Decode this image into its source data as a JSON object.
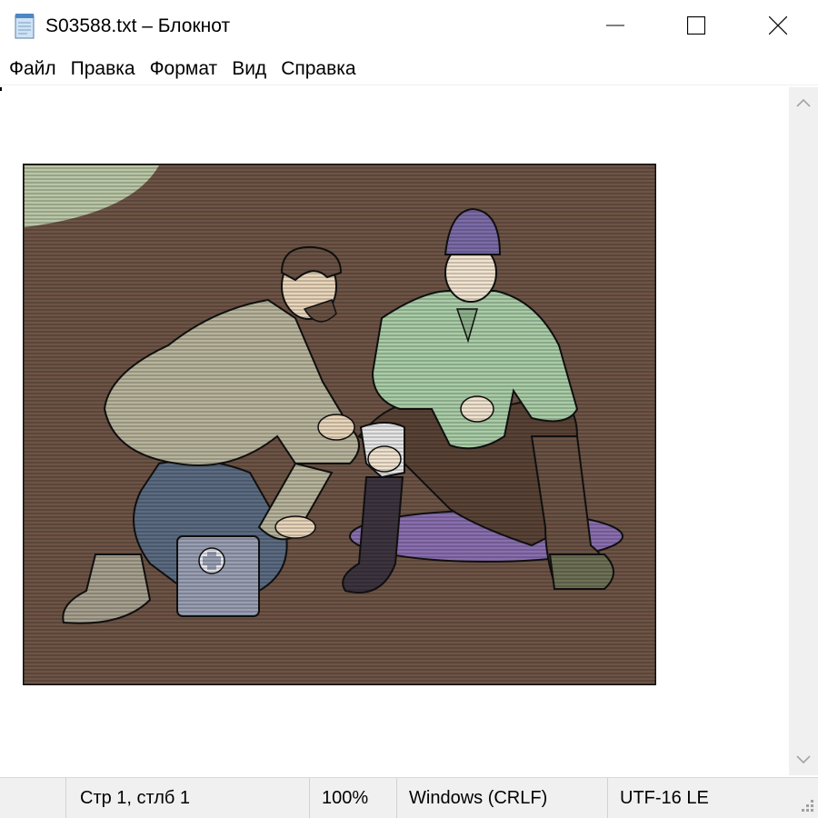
{
  "window": {
    "title": "S03588.txt – Блокнот",
    "app_icon": "notepad-icon",
    "controls": [
      "minimize-icon",
      "maximize-icon",
      "close-icon"
    ]
  },
  "menu": {
    "items": [
      "Файл",
      "Правка",
      "Формат",
      "Вид",
      "Справка"
    ]
  },
  "editor": {
    "content_icon": "image-illustration",
    "scroll_up_icon": "chevron-up-icon",
    "scroll_down_icon": "chevron-down-icon"
  },
  "status": {
    "position": "Стр 1, стлб 1",
    "zoom": "100%",
    "line_endings": "Windows (CRLF)",
    "encoding": "UTF-16 LE"
  },
  "colors": {
    "background": "#ffffff",
    "statusbar": "#f0f0f0",
    "picture_ground": "#6e5446",
    "jacket_green": "#a9cda7",
    "hat_purple": "#7c6ba8"
  }
}
